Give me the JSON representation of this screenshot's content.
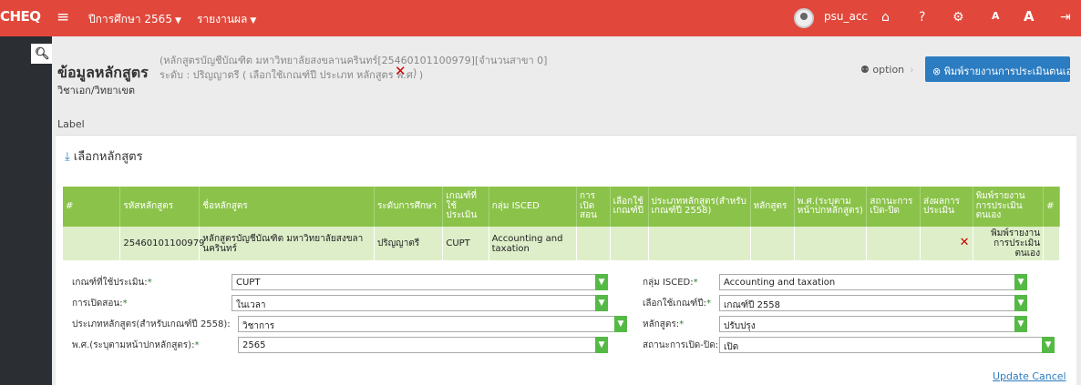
{
  "topbar": {
    "brand": "CHEQ",
    "menu_year": "ปีการศึกษา 2565",
    "menu_report": "รายงานผล",
    "username": "psu_acc",
    "font_small": "A",
    "font_large": "A"
  },
  "header": {
    "title": "ข้อมูลหลักสูตร",
    "sub_line1": "(หลักสูตรบัญชีบัณฑิต มหาวิทยาลัยสงขลานครินทร์[25460101100979][จำนวนสาขา 0]",
    "sub_line2": "ระดับ : ปริญญาตรี ( เลือกใช้เกณฑ์ปี ประเภท หลักสูตร พ.ศ. )",
    "close_paren": ")",
    "major": "วิชาเอก/วิทยาเขต",
    "option": "option",
    "print_button": "พิมพ์รายงานการประเมินตนเอง"
  },
  "label": "Label",
  "panel": {
    "title": "เลือกหลักสูตร"
  },
  "table": {
    "headers": [
      "#",
      "รหัสหลักสูตร",
      "ชื่อหลักสูตร",
      "ระดับการศึกษา",
      "เกณฑ์ที่ใช้ประเมิน",
      "กลุ่ม ISCED",
      "การเปิดสอน",
      "เลือกใช้เกณฑ์ปี",
      "ประเภทหลักสูตร(สำหรับเกณฑ์ปี 2558)",
      "หลักสูตร",
      "พ.ศ.(ระบุตามหน้าปกหลักสูตร)",
      "สถานะการเปิด-ปิด",
      "ส่งผลการประเมิน",
      "พิมพ์รายงานการประเมินตนเอง",
      "#"
    ],
    "row": {
      "code": "25460101100979",
      "name": "หลักสูตรบัญชีบัณฑิต มหาวิทยาลัยสงขลานครินทร์",
      "level": "ปริญญาตรี",
      "criteria": "CUPT",
      "isced": "Accounting and taxation",
      "print": "พิมพ์รายงานการประเมินตนเอง"
    }
  },
  "form": {
    "criteria_label": "เกณฑ์ที่ใช้ประเมิน:",
    "criteria_value": "CUPT",
    "teaching_label": "การเปิดสอน:",
    "teaching_value": "ในเวลา",
    "type_label": "ประเภทหลักสูตร(สำหรับเกณฑ์ปี 2558):",
    "type_value": "วิชาการ",
    "year_label": "พ.ศ.(ระบุตามหน้าปกหลักสูตร):",
    "year_value": "2565",
    "isced_label": "กลุ่ม ISCED:",
    "isced_value": "Accounting and taxation",
    "criteria_year_label": "เลือกใช้เกณฑ์ปี:",
    "criteria_year_value": "เกณฑ์ปี 2558",
    "curriculum_label": "หลักสูตร:",
    "curriculum_value": "ปรับปรุง",
    "status_label": "สถานะการเปิด-ปิด:",
    "status_value": "เปิด",
    "required_mark": "*"
  },
  "actions": {
    "update": "Update",
    "cancel": "Cancel"
  },
  "colors": {
    "topbar": "#e1483b",
    "table_header": "#8bc34a",
    "row": "#ddeec9",
    "primary": "#2c7cc1"
  }
}
